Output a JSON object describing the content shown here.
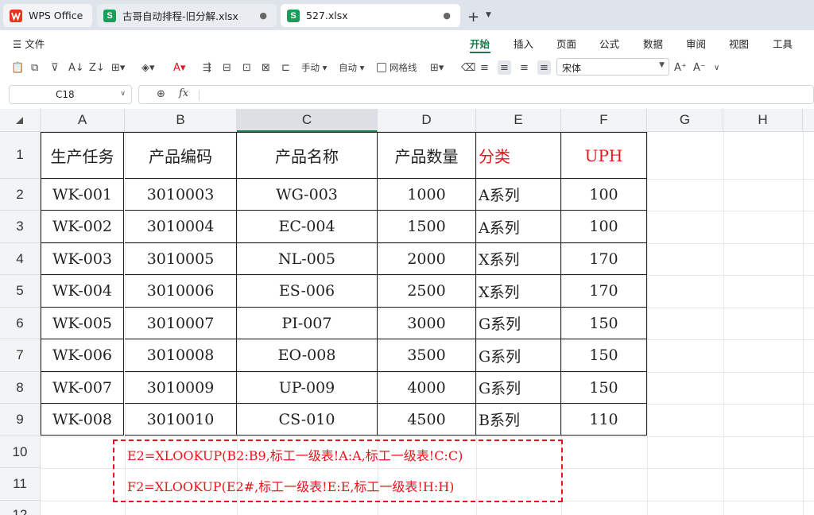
{
  "tabs": [
    {
      "label": "WPS Office",
      "icon": "wps-logo-icon"
    },
    {
      "label": "古哥自动排程-旧分解.xlsx",
      "icon": "sheet-s-icon"
    },
    {
      "label": "527.xlsx",
      "icon": "sheet-s-icon"
    }
  ],
  "menu": {
    "file": "文件",
    "tabs": [
      "开始",
      "插入",
      "页面",
      "公式",
      "数据",
      "审阅",
      "视图",
      "工具"
    ],
    "active": "开始"
  },
  "toolbar": {
    "manual": "手动",
    "auto": "自动",
    "gridlines": "网格线",
    "font": "宋体"
  },
  "formula_bar": {
    "cell_ref": "C18",
    "fx": "fx",
    "content": ""
  },
  "columns": [
    "A",
    "B",
    "C",
    "D",
    "E",
    "F",
    "G",
    "H"
  ],
  "rows": [
    "1",
    "2",
    "3",
    "4",
    "5",
    "6",
    "7",
    "8",
    "9",
    "10",
    "11",
    "12"
  ],
  "table": {
    "header": [
      "生产任务",
      "产品编码",
      "产品名称",
      "产品数量",
      "分类",
      "UPH"
    ],
    "rows": [
      [
        "WK-001",
        "3010003",
        "WG-003",
        "1000",
        "A系列",
        "100"
      ],
      [
        "WK-002",
        "3010004",
        "EC-004",
        "1500",
        "A系列",
        "100"
      ],
      [
        "WK-003",
        "3010005",
        "NL-005",
        "2000",
        "X系列",
        "170"
      ],
      [
        "WK-004",
        "3010006",
        "ES-006",
        "2500",
        "X系列",
        "170"
      ],
      [
        "WK-005",
        "3010007",
        "PI-007",
        "3000",
        "G系列",
        "150"
      ],
      [
        "WK-006",
        "3010008",
        "EO-008",
        "3500",
        "G系列",
        "150"
      ],
      [
        "WK-007",
        "3010009",
        "UP-009",
        "4000",
        "G系列",
        "150"
      ],
      [
        "WK-008",
        "3010010",
        "CS-010",
        "4500",
        "B系列",
        "110"
      ]
    ]
  },
  "note": {
    "line1": "E2=XLOOKUP(B2:B9,标工一级表!A:A,标工一级表!C:C)",
    "line2": "F2=XLOOKUP(E2#,标工一级表!E:E,标工一级表!H:H)"
  },
  "colors": {
    "accent": "#1b7a4a",
    "red_text": "#e8141b"
  }
}
